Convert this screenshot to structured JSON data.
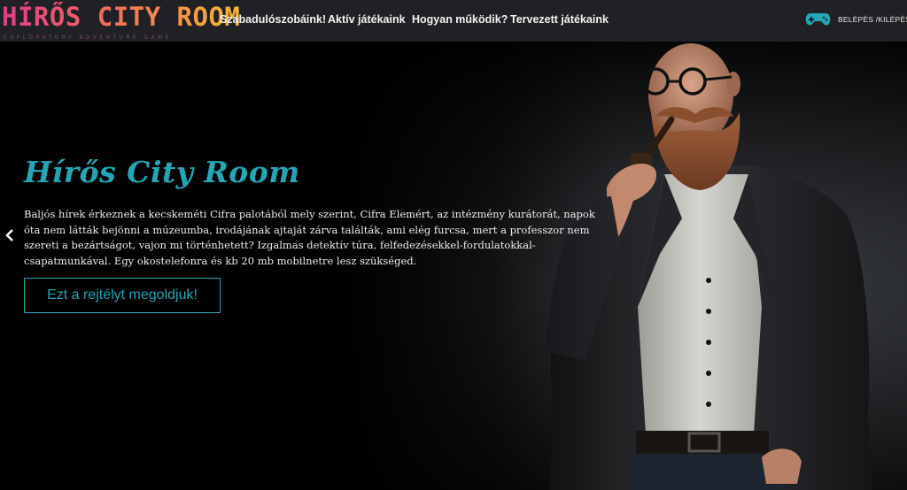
{
  "brand": {
    "title": "HÍRŐS CITY ROOM",
    "subtitle": "EXPLORATORY ADVENTURE GAME"
  },
  "nav": {
    "items": [
      {
        "label": "Szabadulószobáink!"
      },
      {
        "label": "Aktív játékaink"
      },
      {
        "label": "Hogyan működik?"
      },
      {
        "label": "Tervezett játékaink"
      }
    ],
    "login_label": "BELÉPÉS /KILÉPÉS",
    "login_icon": "gamepad-icon"
  },
  "hero": {
    "title": "Hírős City Room",
    "text": "Baljós hírek érkeznek a  kecskeméti Cifra palotából mely szerint, Cifra Elemért, az intézmény kurátorát, napok óta nem látták bejönni a múzeumba, irodájának ajtaját zárva találták, ami elég furcsa, mert a professzor nem szereti a bezártságot, vajon mi történhetett? Izgalmas detektív túra, felfedezésekkel-fordulatokkal-csapatmunkával. Egy okostelefonra és kb 20 mb mobilnetre lesz szükséged.",
    "button_label": "Ezt a rejtélyt megoldjuk!",
    "prev_icon": "chevron-left-icon"
  },
  "colors": {
    "accent": "#23a7b6",
    "navbar_bg": "#202124",
    "logo_gradient": [
      "#e23a8c",
      "#f06d5a",
      "#f7b733"
    ]
  }
}
